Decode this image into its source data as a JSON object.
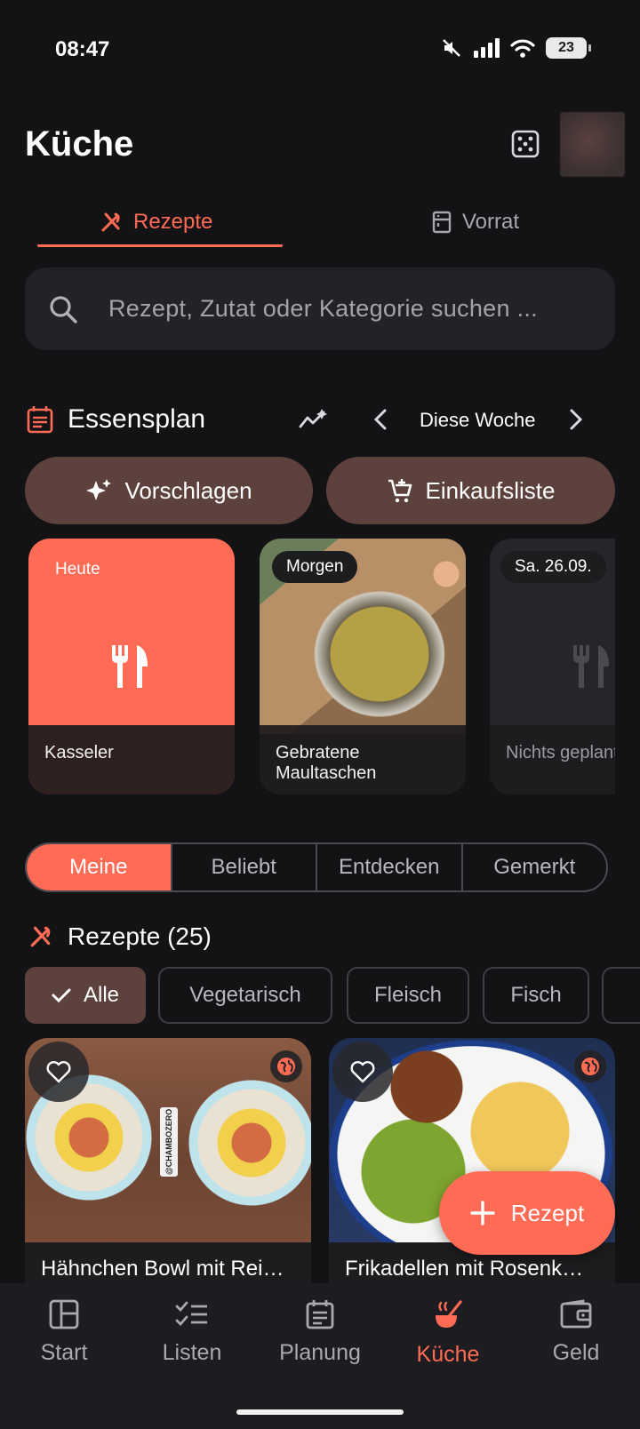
{
  "status_bar": {
    "time": "08:47",
    "battery": "23"
  },
  "header": {
    "title": "Küche"
  },
  "tabs": [
    {
      "label": "Rezepte",
      "icon": "utensils-icon"
    },
    {
      "label": "Vorrat",
      "icon": "pantry-icon"
    }
  ],
  "search": {
    "placeholder": "Rezept, Zutat oder Kategorie suchen ..."
  },
  "meal_plan": {
    "title": "Essensplan",
    "week_label": "Diese Woche",
    "suggest_label": "Vorschlagen",
    "shopping_label": "Einkaufsliste",
    "days": [
      {
        "label": "Heute",
        "meal": "Kasseler"
      },
      {
        "label": "Morgen",
        "meal": "Gebratene Maultaschen"
      },
      {
        "label": "Sa. 26.09.",
        "meal": "Nichts geplant"
      }
    ]
  },
  "filter_tabs": [
    "Meine",
    "Beliebt",
    "Entdecken",
    "Gemerkt"
  ],
  "recipes": {
    "title": "Rezepte (25)",
    "categories": [
      "Alle",
      "Vegetarisch",
      "Fleisch",
      "Fisch"
    ],
    "items": [
      {
        "title": "Hähnchen Bowl mit Rei…",
        "watermark": "@CHAMBOZERO"
      },
      {
        "title": "Frikadellen mit Rosenk…"
      }
    ],
    "add_label": "Rezept"
  },
  "nav": [
    {
      "label": "Start",
      "icon": "dashboard-icon"
    },
    {
      "label": "Listen",
      "icon": "checklist-icon"
    },
    {
      "label": "Planung",
      "icon": "calendar-icon"
    },
    {
      "label": "Küche",
      "icon": "cooking-icon",
      "active": true
    },
    {
      "label": "Geld",
      "icon": "wallet-icon"
    }
  ],
  "colors": {
    "accent": "#ff6b55",
    "background": "#131316",
    "surface": "#232327",
    "brown_button": "#5d413d"
  }
}
